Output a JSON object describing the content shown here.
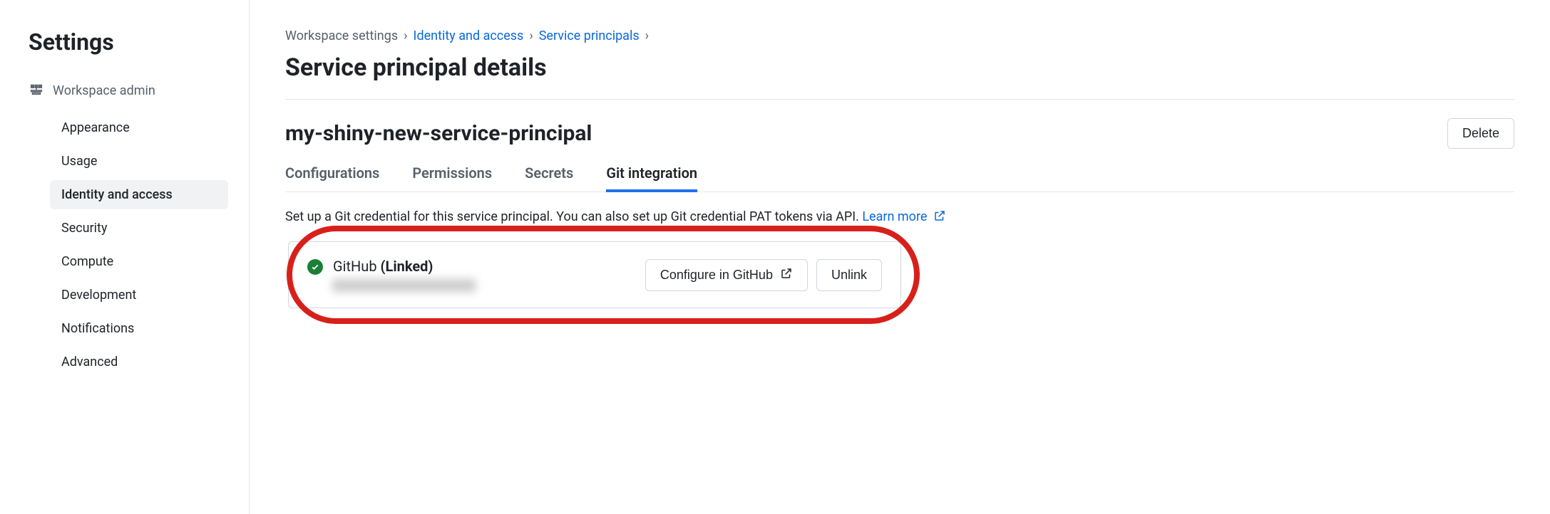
{
  "sidebar": {
    "title": "Settings",
    "group_label": "Workspace admin",
    "items": [
      {
        "label": "Appearance",
        "active": false
      },
      {
        "label": "Usage",
        "active": false
      },
      {
        "label": "Identity and access",
        "active": true
      },
      {
        "label": "Security",
        "active": false
      },
      {
        "label": "Compute",
        "active": false
      },
      {
        "label": "Development",
        "active": false
      },
      {
        "label": "Notifications",
        "active": false
      },
      {
        "label": "Advanced",
        "active": false
      }
    ]
  },
  "breadcrumb": {
    "items": [
      {
        "label": "Workspace settings",
        "link": false
      },
      {
        "label": "Identity and access",
        "link": true
      },
      {
        "label": "Service principals",
        "link": true
      }
    ]
  },
  "page": {
    "title": "Service principal details",
    "principal_name": "my-shiny-new-service-principal",
    "delete_label": "Delete"
  },
  "tabs": [
    {
      "label": "Configurations",
      "active": false
    },
    {
      "label": "Permissions",
      "active": false
    },
    {
      "label": "Secrets",
      "active": false
    },
    {
      "label": "Git integration",
      "active": true
    }
  ],
  "description": {
    "text": "Set up a Git credential for this service principal. You can also set up Git credential PAT tokens via API. ",
    "learn_more": "Learn more"
  },
  "git_card": {
    "provider": "GitHub",
    "status": "(Linked)",
    "configure_label": "Configure in GitHub",
    "unlink_label": "Unlink"
  }
}
